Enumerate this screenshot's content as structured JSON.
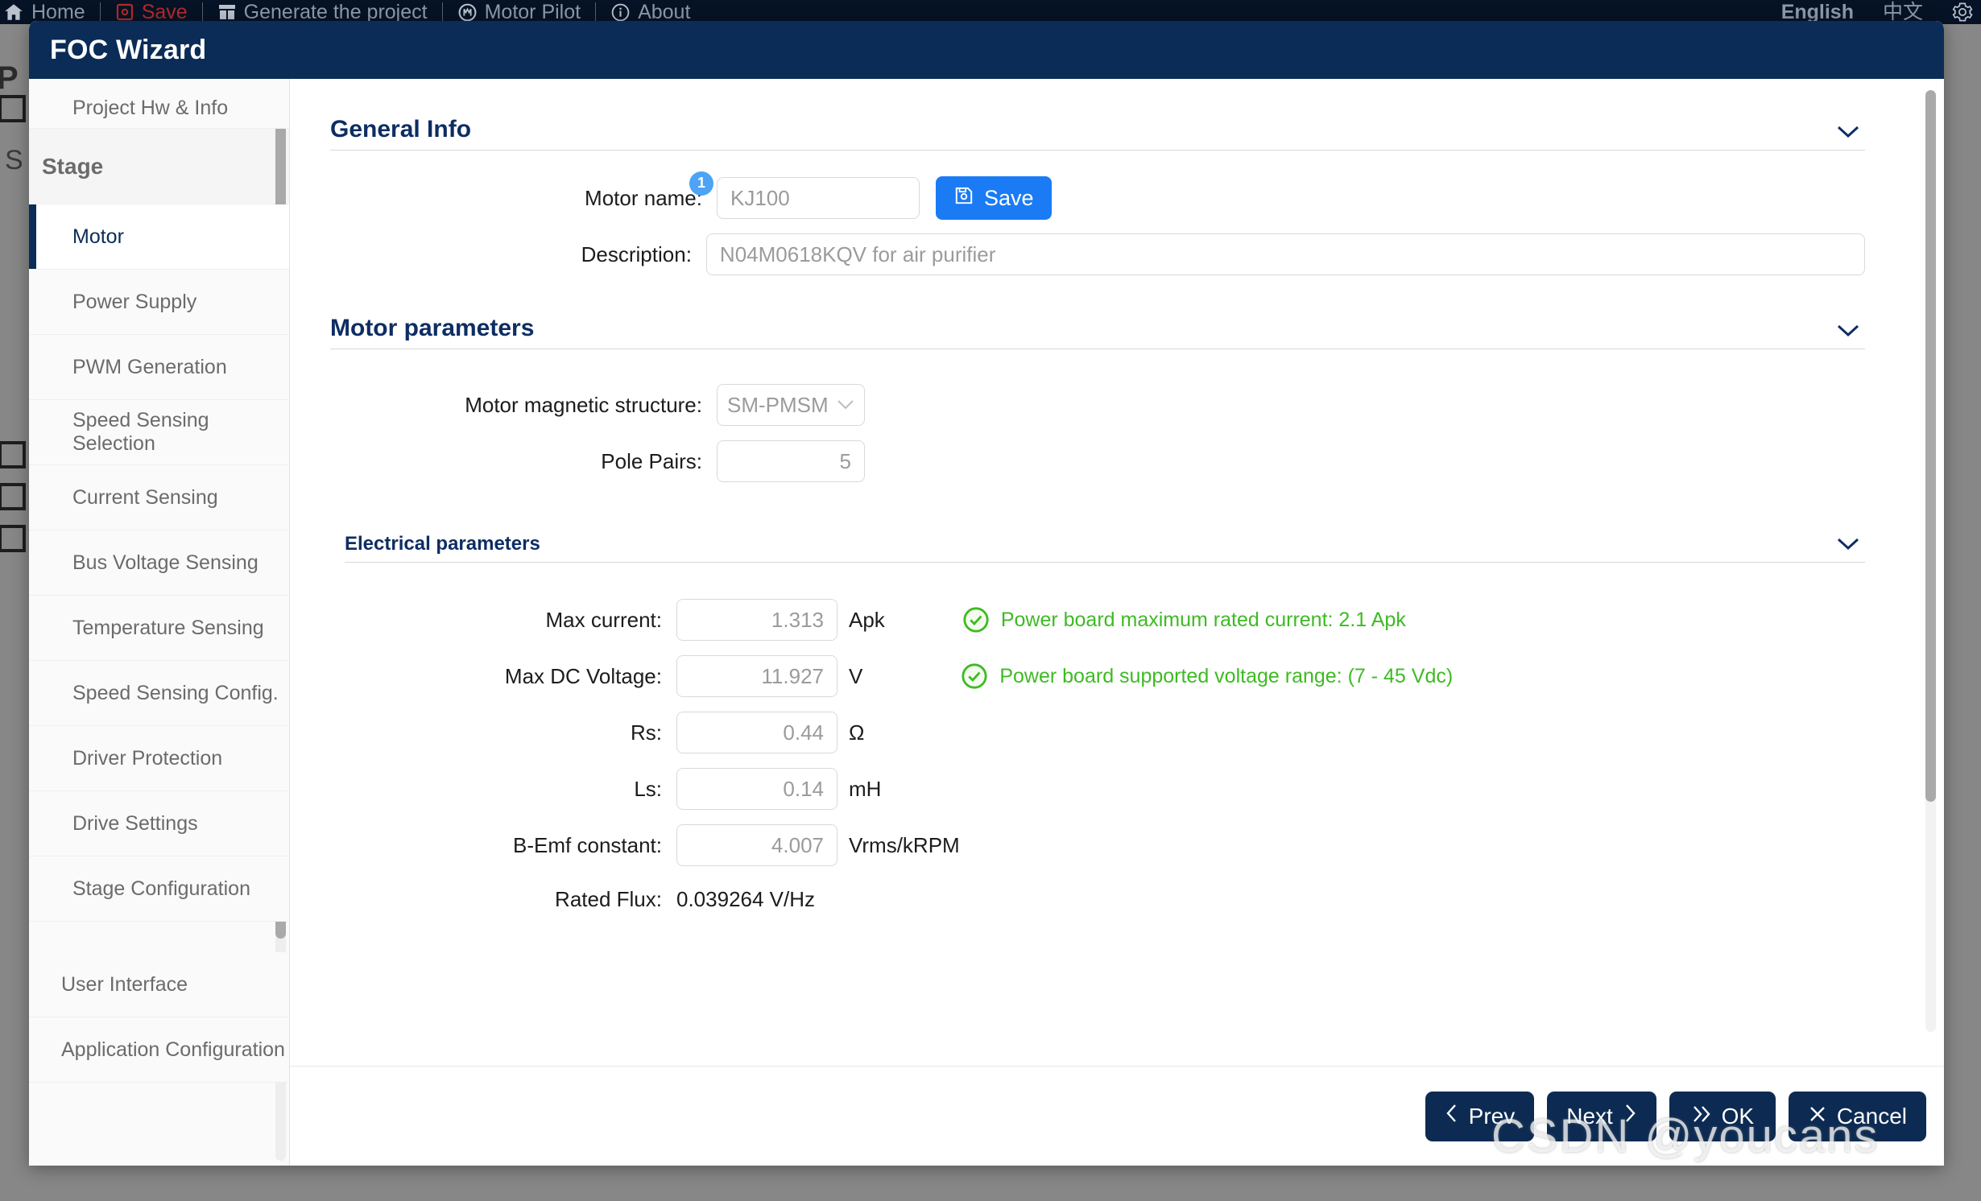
{
  "menubar": {
    "items": [
      {
        "icon": "home-icon",
        "label": "Home"
      },
      {
        "icon": "save-icon",
        "label": "Save"
      },
      {
        "icon": "package-icon",
        "label": "Generate the project"
      },
      {
        "icon": "motor-icon",
        "label": "Motor Pilot"
      },
      {
        "icon": "info-icon",
        "label": "About"
      }
    ],
    "language_en": "English",
    "language_zh": "中文",
    "settings_icon": "gear-icon"
  },
  "background": {
    "text_p": "P",
    "text_s": "S"
  },
  "dialog": {
    "title": "FOC Wizard"
  },
  "sidebar": {
    "project_item": "Project Hw & Info",
    "stage_header": "Stage",
    "stage_items": [
      "Motor",
      "Power Supply",
      "PWM Generation",
      "Speed Sensing Selection",
      "Current Sensing",
      "Bus Voltage Sensing",
      "Temperature Sensing",
      "Speed Sensing Config.",
      "Driver Protection",
      "Drive Settings"
    ],
    "stage_config_item": "Stage Configuration",
    "tail_items": [
      "User Interface",
      "Application Configuration"
    ],
    "active_item": "Motor"
  },
  "general_info": {
    "title": "General Info",
    "chevron": "chevron-down-icon",
    "motor_name_label": "Motor name:",
    "motor_name_badge": "1",
    "motor_name_value": "KJ100",
    "save_label": "Save",
    "description_label": "Description:",
    "description_value": "N04M0618KQV for air purifier"
  },
  "motor_parameters": {
    "title": "Motor parameters",
    "chevron": "chevron-down-icon",
    "magnetic_structure_label": "Motor magnetic structure:",
    "magnetic_structure_value": "SM-PMSM",
    "magnetic_structure_options": [
      "SM-PMSM"
    ],
    "pole_pairs_label": "Pole Pairs:",
    "pole_pairs_value": "5"
  },
  "electrical_parameters": {
    "title": "Electrical parameters",
    "chevron": "chevron-down-icon",
    "rows": [
      {
        "label": "Max current:",
        "value": "1.313",
        "unit": "Apk",
        "status": "Power board maximum rated current: 2.1 Apk"
      },
      {
        "label": "Max DC Voltage:",
        "value": "11.927",
        "unit": "V",
        "status": "Power board supported voltage range: (7 - 45 Vdc)"
      },
      {
        "label": "Rs:",
        "value": "0.44",
        "unit": "Ω",
        "status": ""
      },
      {
        "label": "Ls:",
        "value": "0.14",
        "unit": "mH",
        "status": ""
      },
      {
        "label": "B-Emf constant:",
        "value": "4.007",
        "unit": "Vrms/kRPM",
        "status": ""
      }
    ],
    "rated_flux_label": "Rated Flux:",
    "rated_flux_value": "0.039264 V/Hz"
  },
  "footer": {
    "prev_label": "Prev",
    "next_label": "Next",
    "ok_label": "OK",
    "cancel_label": "Cancel"
  },
  "watermark": "CSDN @youcans",
  "colors": {
    "brand_navy": "#0a2c56",
    "accent_blue": "#1a7bf5",
    "badge_blue": "#4da3f5",
    "success_green": "#3dbb22",
    "menubar_bg": "#061326"
  }
}
